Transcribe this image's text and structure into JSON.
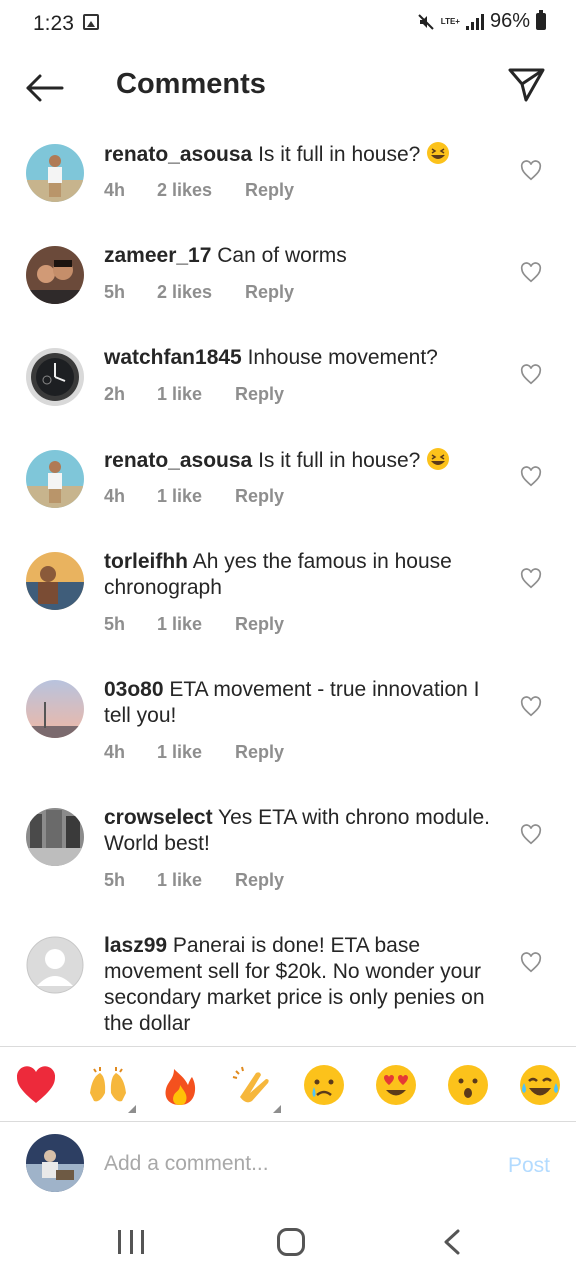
{
  "status_bar": {
    "time": "1:23",
    "lte": "LTE+",
    "battery": "96%"
  },
  "header": {
    "title": "Comments"
  },
  "comments": [
    {
      "user": "renato_asousa",
      "text": "Is it full in house?",
      "has_emoji": true,
      "age": "4h",
      "likes": "2 likes",
      "reply": "Reply"
    },
    {
      "user": "zameer_17",
      "text": "Can of worms",
      "has_emoji": false,
      "age": "5h",
      "likes": "2 likes",
      "reply": "Reply"
    },
    {
      "user": "watchfan1845",
      "text": "Inhouse movement?",
      "has_emoji": false,
      "age": "2h",
      "likes": "1 like",
      "reply": "Reply"
    },
    {
      "user": "renato_asousa",
      "text": "Is it full in house?",
      "has_emoji": true,
      "age": "4h",
      "likes": "1 like",
      "reply": "Reply"
    },
    {
      "user": "torleifhh",
      "text": "Ah yes the famous in house chronograph",
      "has_emoji": false,
      "age": "5h",
      "likes": "1 like",
      "reply": "Reply"
    },
    {
      "user": "03o80",
      "text": "ETA movement - true innovation I tell you!",
      "has_emoji": false,
      "age": "4h",
      "likes": "1 like",
      "reply": "Reply"
    },
    {
      "user": "crowselect",
      "text": "Yes ETA with chrono module. World best!",
      "has_emoji": false,
      "age": "5h",
      "likes": "1 like",
      "reply": "Reply"
    },
    {
      "user": "lasz99",
      "text": "Panerai is done! ETA base movement sell for $20k. No wonder your secondary market price is only penies on the dollar",
      "has_emoji": false,
      "age": "",
      "likes": "",
      "reply": ""
    }
  ],
  "emoji_bar": [
    "red-heart",
    "raising-hands",
    "fire",
    "clapping-hands",
    "crying-face",
    "heart-eyes-face",
    "surprised-face",
    "tears-of-joy-face"
  ],
  "composer": {
    "placeholder": "Add a comment...",
    "post_label": "Post"
  },
  "colors": {
    "accent_disabled": "#b3dbff",
    "secondary_text": "#8e8e8e",
    "heart_red": "#ed2a3b"
  }
}
